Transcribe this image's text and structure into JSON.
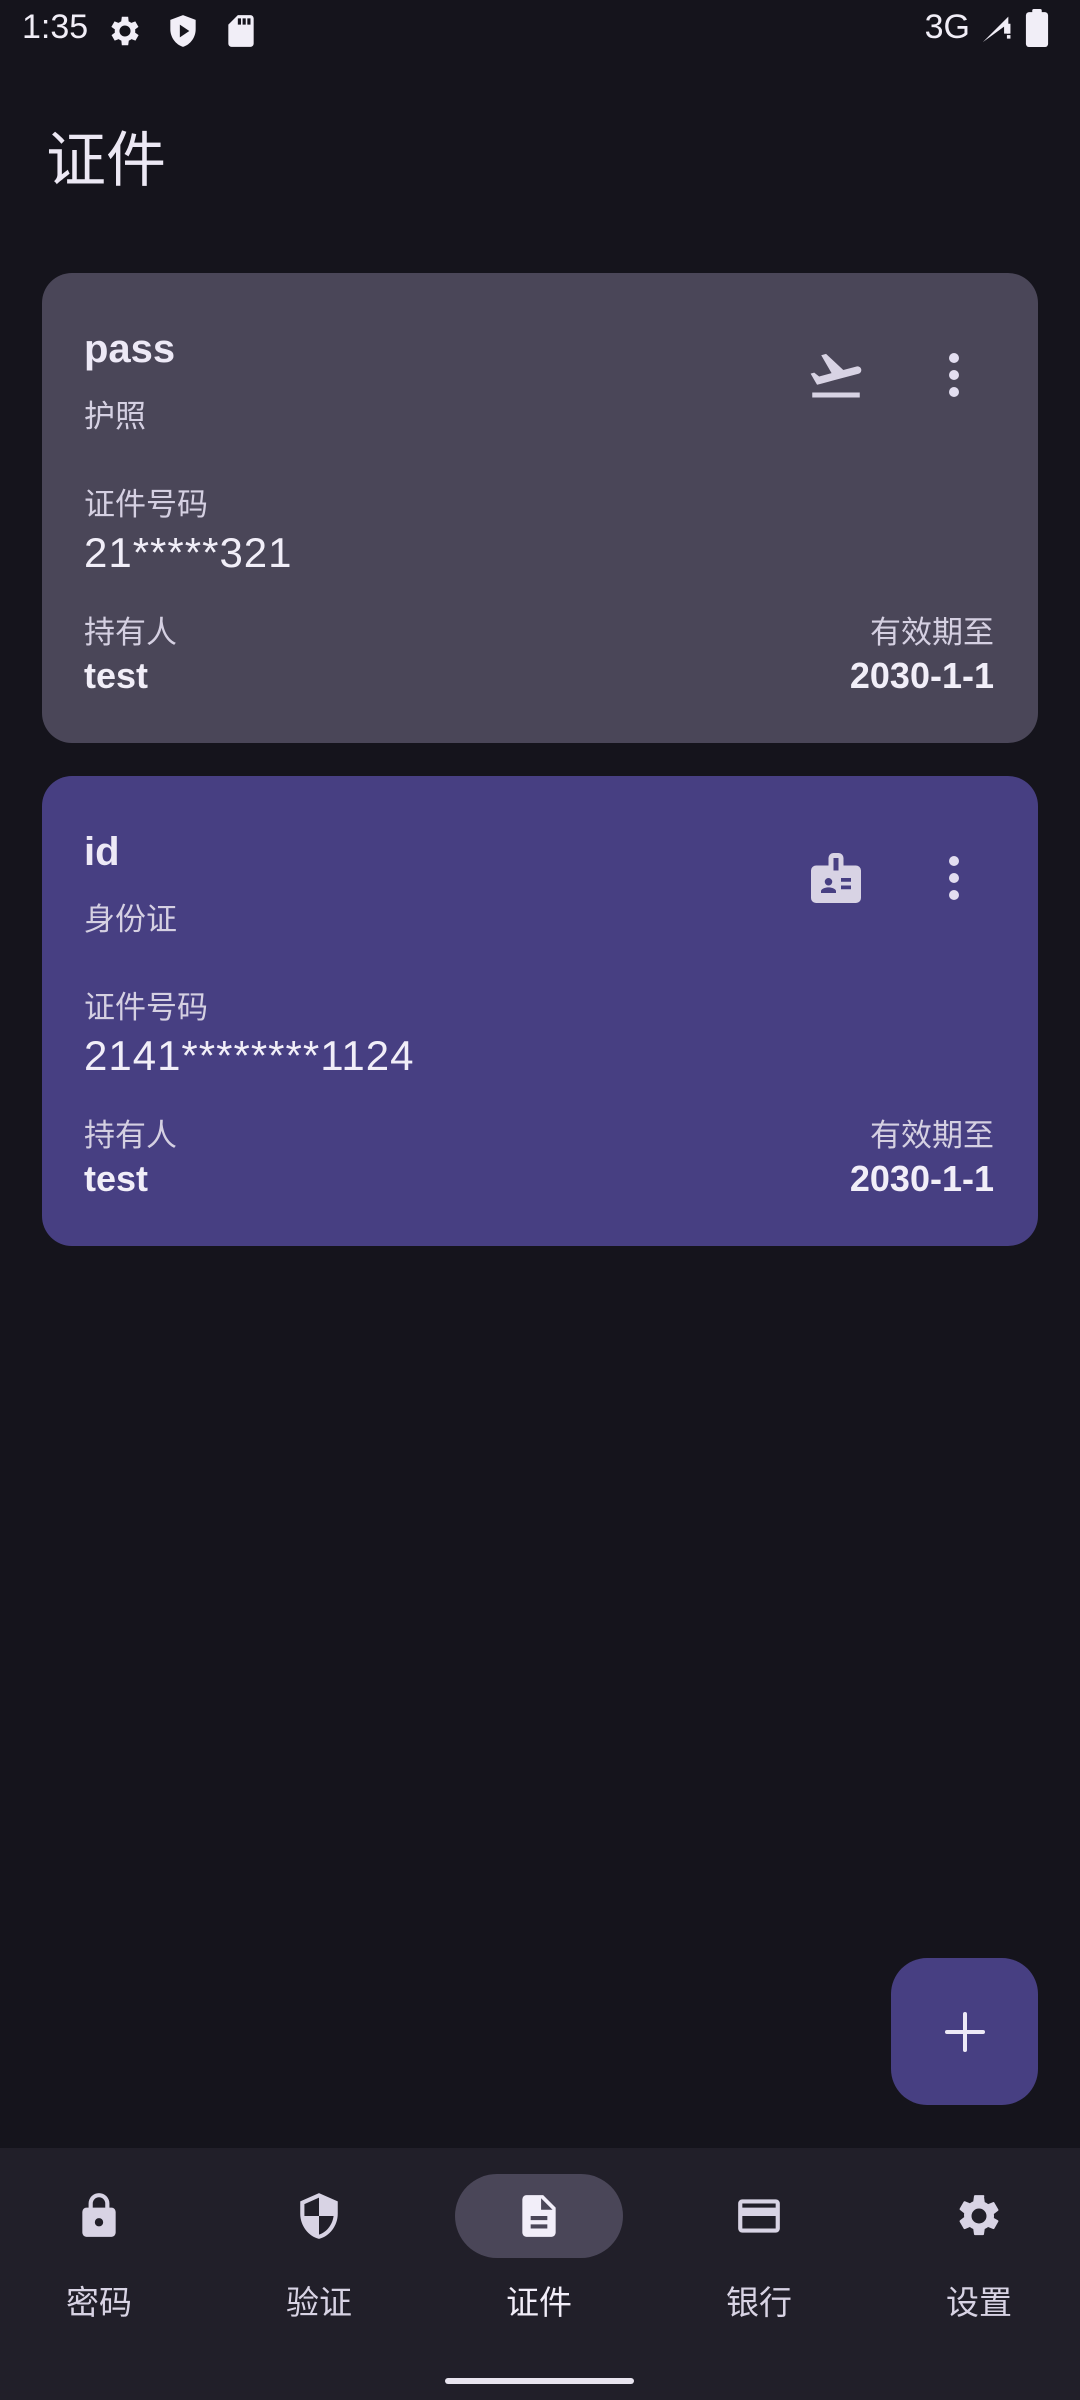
{
  "status_bar": {
    "time": "1:35",
    "network": "3G",
    "icons": [
      "settings-icon",
      "play-protect-icon",
      "sd-card-icon",
      "signal-icon",
      "battery-icon"
    ]
  },
  "page": {
    "title": "证件"
  },
  "cards": [
    {
      "name": "pass",
      "type": "护照",
      "icon": "airplane-takeoff-icon",
      "number_label": "证件号码",
      "number": "21*****321",
      "holder_label": "持有人",
      "holder": "test",
      "expiry_label": "有效期至",
      "expiry": "2030-1-1",
      "color": "#4a4658"
    },
    {
      "name": "id",
      "type": "身份证",
      "icon": "id-badge-icon",
      "number_label": "证件号码",
      "number": "2141********1124",
      "holder_label": "持有人",
      "holder": "test",
      "expiry_label": "有效期至",
      "expiry": "2030-1-1",
      "color": "#473f82"
    }
  ],
  "fab": {
    "icon": "plus-icon"
  },
  "nav": {
    "items": [
      {
        "label": "密码",
        "icon": "lock-icon"
      },
      {
        "label": "验证",
        "icon": "shield-icon"
      },
      {
        "label": "证件",
        "icon": "document-icon",
        "active": true
      },
      {
        "label": "银行",
        "icon": "credit-card-icon"
      },
      {
        "label": "设置",
        "icon": "gear-icon"
      }
    ]
  },
  "colors": {
    "background": "#15141c",
    "accent": "#473f82",
    "card_neutral": "#4a4658",
    "nav_background": "#211f29"
  }
}
